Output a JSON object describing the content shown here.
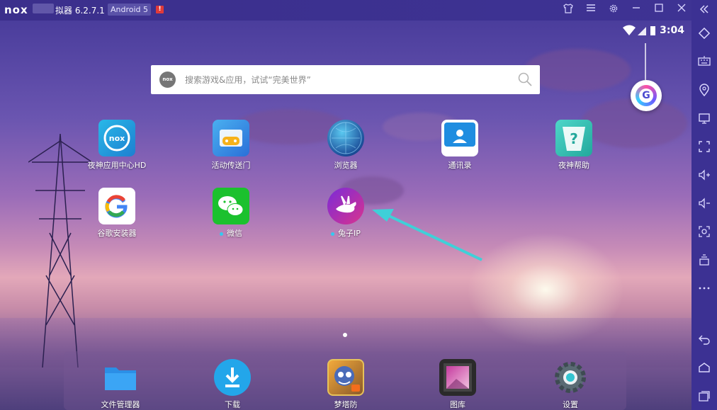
{
  "titlebar": {
    "logo": "nox",
    "app_title": "拟器 6.2.7.1",
    "version_badge": "Android 5",
    "alert_badge": "!",
    "buttons": [
      "shirt-icon",
      "menu-icon",
      "gear-icon",
      "minimize-icon",
      "maximize-icon",
      "close-icon",
      "collapse-icon"
    ]
  },
  "status_bar": {
    "time": "3:04"
  },
  "search": {
    "placeholder": "搜索游戏&应用，试试“完美世界”",
    "logo_text": "nox"
  },
  "apps": [
    {
      "label": "夜神应用中心HD",
      "icon": "nox-app-center-icon"
    },
    {
      "label": "活动传送门",
      "icon": "gamepad-portal-icon"
    },
    {
      "label": "浏览器",
      "icon": "globe-browser-icon"
    },
    {
      "label": "通讯录",
      "icon": "contacts-icon"
    },
    {
      "label": "夜神帮助",
      "icon": "help-icon"
    },
    {
      "label": "谷歌安装器",
      "icon": "google-installer-icon"
    },
    {
      "label": "微信",
      "icon": "wechat-icon"
    },
    {
      "label": "兔子IP",
      "icon": "rabbit-ip-icon"
    }
  ],
  "dock": [
    {
      "label": "文件管理器",
      "icon": "folder-icon"
    },
    {
      "label": "下载",
      "icon": "download-icon"
    },
    {
      "label": "梦塔防",
      "icon": "game-icon"
    },
    {
      "label": "图库",
      "icon": "gallery-icon"
    },
    {
      "label": "设置",
      "icon": "settings-gear-icon"
    }
  ],
  "sidebar": [
    "rotate-icon",
    "keyboard-icon",
    "location-icon",
    "screen-icon",
    "fullscreen-icon",
    "volume-up-icon",
    "volume-down-icon",
    "screenshot-icon",
    "multi-instance-icon",
    "more-icon",
    "back-icon",
    "home-icon",
    "recents-icon"
  ],
  "colors": {
    "accent": "#3c3193",
    "badge_red": "#e03a3a",
    "arrow": "#3fd0d8"
  }
}
